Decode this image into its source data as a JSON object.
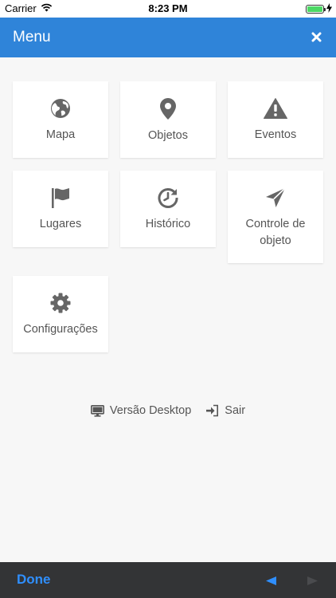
{
  "status_bar": {
    "carrier": "Carrier",
    "time": "8:23 PM",
    "battery_level": 1.0
  },
  "header": {
    "title": "Menu",
    "close_icon": "close-icon"
  },
  "tiles": [
    {
      "label": "Mapa",
      "icon": "globe-icon"
    },
    {
      "label": "Objetos",
      "icon": "map-marker-icon"
    },
    {
      "label": "Eventos",
      "icon": "warning-icon"
    },
    {
      "label": "Lugares",
      "icon": "flag-icon"
    },
    {
      "label": "Histórico",
      "icon": "history-icon"
    },
    {
      "label": "Controle de objeto",
      "icon": "send-icon"
    },
    {
      "label": "Configurações",
      "icon": "gear-icon"
    }
  ],
  "links": {
    "desktop_label": "Versão Desktop",
    "desktop_icon": "monitor-icon",
    "logout_label": "Sair",
    "logout_icon": "sign-in-icon"
  },
  "toolbar": {
    "done_label": "Done",
    "prev_icon": "triangle-left-icon",
    "next_icon": "triangle-right-icon"
  },
  "colors": {
    "header": "#2f84d9",
    "toolbar": "#333436",
    "done": "#2f8fff",
    "icon": "#666666"
  }
}
